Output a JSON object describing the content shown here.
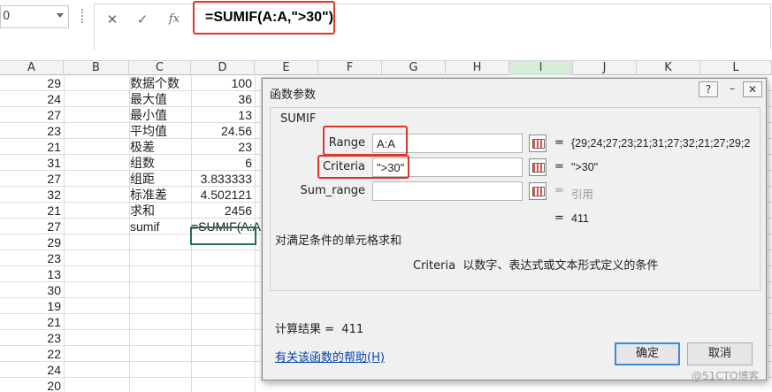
{
  "formula_bar": {
    "name_box_value": "0",
    "cancel_icon": "✕",
    "enter_icon": "✓",
    "fx_icon": "fx",
    "formula": "=SUMIF(A:A,\">30\")"
  },
  "columns": [
    "A",
    "B",
    "C",
    "D",
    "E",
    "F",
    "G",
    "H",
    "I",
    "J",
    "K",
    "L"
  ],
  "selected_column": "I",
  "rows": [
    {
      "a": "29",
      "c": "数据个数",
      "d": "100"
    },
    {
      "a": "24",
      "c": "最大值",
      "d": "36"
    },
    {
      "a": "27",
      "c": "最小值",
      "d": "13"
    },
    {
      "a": "23",
      "c": "平均值",
      "d": "24.56"
    },
    {
      "a": "21",
      "c": "极差",
      "d": "23"
    },
    {
      "a": "31",
      "c": "组数",
      "d": "6"
    },
    {
      "a": "27",
      "c": "组距",
      "d": "3.833333"
    },
    {
      "a": "32",
      "c": "标准差",
      "d": "4.502121"
    },
    {
      "a": "21",
      "c": "求和",
      "d": "2456"
    },
    {
      "a": "27",
      "c": "sumif",
      "d": "=SUMIF(A:A"
    },
    {
      "a": "29",
      "c": "",
      "d": ""
    },
    {
      "a": "23",
      "c": "",
      "d": ""
    },
    {
      "a": "13",
      "c": "",
      "d": ""
    },
    {
      "a": "30",
      "c": "",
      "d": ""
    },
    {
      "a": "19",
      "c": "",
      "d": ""
    },
    {
      "a": "21",
      "c": "",
      "d": ""
    },
    {
      "a": "23",
      "c": "",
      "d": ""
    },
    {
      "a": "22",
      "c": "",
      "d": ""
    },
    {
      "a": "24",
      "c": "",
      "d": ""
    },
    {
      "a": "20",
      "c": "",
      "d": ""
    }
  ],
  "dialog": {
    "title": "函数参数",
    "help_button": "?",
    "close_button": "✕",
    "function_name": "SUMIF",
    "params": [
      {
        "label": "Range",
        "input": "A:A",
        "value": "{29;24;27;23;21;31;27;32;21;27;29;2"
      },
      {
        "label": "Criteria",
        "input": "\">30\"",
        "value": "\">30\""
      },
      {
        "label": "Sum_range",
        "input": "",
        "value": "引用"
      }
    ],
    "result_preview": "411",
    "function_description": "对满足条件的单元格求和",
    "param_description_name": "Criteria",
    "param_description": "以数字、表达式或文本形式定义的条件",
    "calc_result_label": "计算结果 =",
    "calc_result_value": "411",
    "help_link": "有关该函数的帮助(H)",
    "ok_label": "确定",
    "cancel_label": "取消"
  },
  "watermark": "@51CTO博客",
  "colors": {
    "accent_red": "#e0342b",
    "excel_green": "#217346",
    "link_blue": "#0645ad"
  }
}
